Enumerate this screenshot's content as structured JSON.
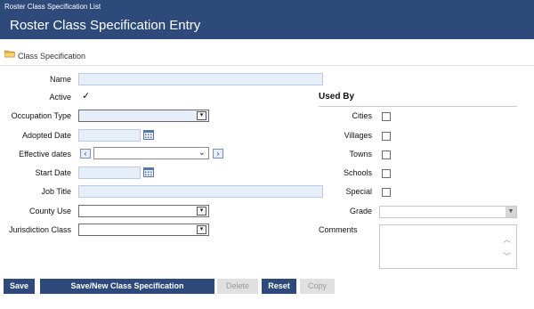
{
  "header": {
    "breadcrumb": "Roster Class Specification List",
    "title": "Roster Class Specification Entry"
  },
  "section": {
    "label": "Class Specification",
    "icon": "folder-icon"
  },
  "form": {
    "name_label": "Name",
    "name_value": "",
    "active_label": "Active",
    "active_checked": true,
    "occupation_type_label": "Occupation Type",
    "occupation_type_value": "",
    "adopted_date_label": "Adopted Date",
    "adopted_date_value": "",
    "effective_dates_label": "Effective dates",
    "effective_dates_value": "",
    "start_date_label": "Start Date",
    "start_date_value": "",
    "job_title_label": "Job Title",
    "job_title_value": "",
    "county_use_label": "County Use",
    "county_use_value": "",
    "jurisdiction_class_label": "Jurisdiction Class",
    "jurisdiction_class_value": ""
  },
  "used_by": {
    "heading": "Used By",
    "items": [
      {
        "label": "Cities",
        "checked": false
      },
      {
        "label": "Villages",
        "checked": false
      },
      {
        "label": "Towns",
        "checked": false
      },
      {
        "label": "Schools",
        "checked": false
      },
      {
        "label": "Special",
        "checked": false
      }
    ],
    "grade_label": "Grade",
    "grade_value": "",
    "comments_label": "Comments",
    "comments_value": ""
  },
  "buttons": {
    "save": "Save",
    "save_new": "Save/New Class Specification",
    "delete": "Delete",
    "reset": "Reset",
    "copy": "Copy"
  },
  "colors": {
    "header_bg": "#2e4a7a",
    "input_bg": "#e5eef9",
    "disabled_bg": "#e0e0e0"
  }
}
